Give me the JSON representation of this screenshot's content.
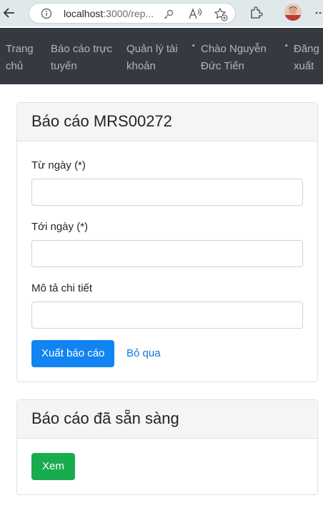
{
  "browser": {
    "url_host": "localhost",
    "url_rest": ":3000/rep..."
  },
  "nav": {
    "items": [
      {
        "label": "Trang chủ"
      },
      {
        "label": "Báo cáo trực tuyến"
      },
      {
        "label": "Quản lý tài khoản"
      },
      {
        "label": "Chào Nguyễn Đức Tiến"
      },
      {
        "label": "Đăng xuất"
      }
    ]
  },
  "report_form": {
    "title": "Báo cáo MRS00272",
    "from_date_label": "Từ ngày (*)",
    "from_date_value": "",
    "to_date_label": "Tới ngày (*)",
    "to_date_value": "",
    "description_label": "Mô tả chi tiết",
    "description_value": "",
    "export_button": "Xuất báo cáo",
    "skip_link": "Bỏ qua"
  },
  "ready": {
    "title": "Báo cáo đã sẵn sàng",
    "view_button": "Xem"
  },
  "colors": {
    "navbar_bg": "#343a40",
    "primary": "#1284f2",
    "success": "#19ac4f",
    "link": "#1276dc"
  }
}
